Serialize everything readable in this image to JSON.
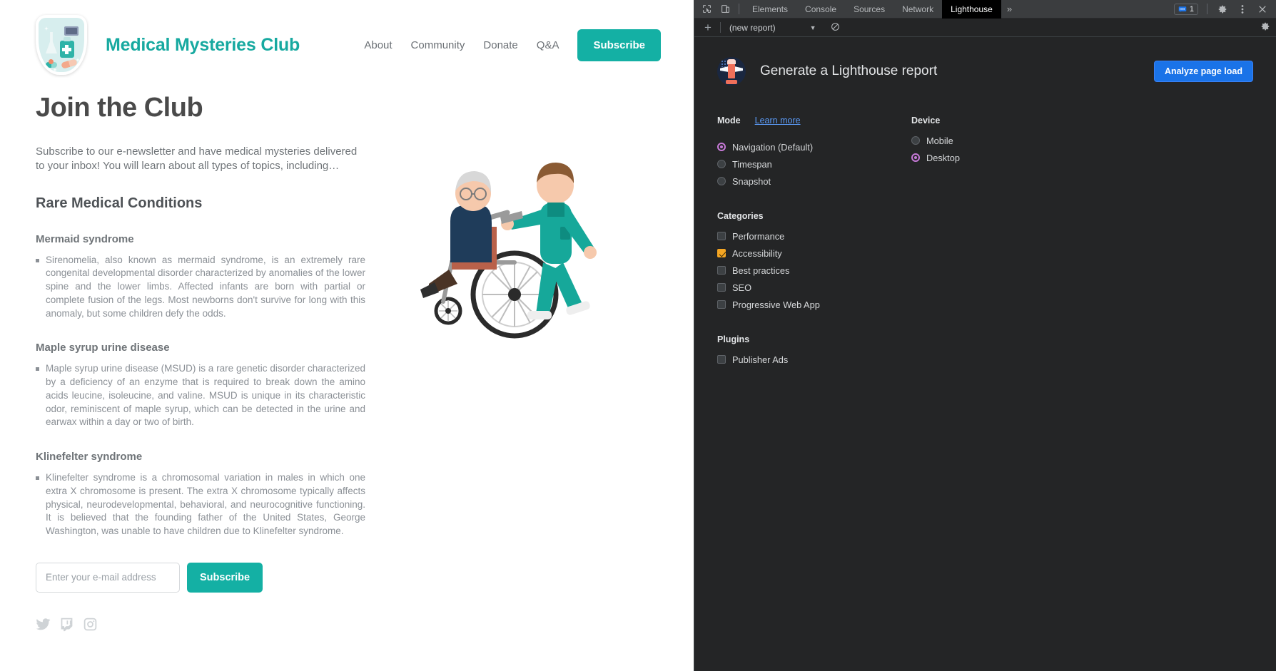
{
  "site": {
    "brand": "Medical Mysteries Club",
    "logo_icon": "medical-shield-logo",
    "nav": [
      {
        "label": "About"
      },
      {
        "label": "Community"
      },
      {
        "label": "Donate"
      },
      {
        "label": "Q&A"
      }
    ],
    "nav_cta": "Subscribe",
    "heading": "Join the Club",
    "lede": "Subscribe to our e-newsletter and have medical mysteries delivered to your inbox! You will learn about all types of topics, including…",
    "section_heading": "Rare Medical Conditions",
    "conditions": [
      {
        "title": "Mermaid syndrome",
        "body": "Sirenomelia, also known as mermaid syndrome, is an extremely rare congenital developmental disorder characterized by anomalies of the lower spine and the lower limbs. Affected infants are born with partial or complete fusion of the legs. Most newborns don't survive for long with this anomaly, but some children defy the odds."
      },
      {
        "title": "Maple syrup urine disease",
        "body": "Maple syrup urine disease (MSUD) is a rare genetic disorder characterized by a deficiency of an enzyme that is required to break down the amino acids leucine, isoleucine, and valine. MSUD is unique in its characteristic odor, reminiscent of maple syrup, which can be detected in the urine and earwax within a day or two of birth."
      },
      {
        "title": "Klinefelter syndrome",
        "body": "Klinefelter syndrome is a chromosomal variation in males in which one extra X chromosome is present. The extra X chromosome typically affects physical, neurodevelopmental, behavioral, and neurocognitive functioning. It is believed that the founding father of the United States, George Washington, was unable to have children due to Klinefelter syndrome."
      }
    ],
    "form": {
      "email_placeholder": "Enter your e-mail address",
      "email_value": "",
      "submit_label": "Subscribe"
    },
    "socials": [
      {
        "name": "twitter-icon"
      },
      {
        "name": "twitch-icon"
      },
      {
        "name": "instagram-icon"
      }
    ],
    "illustration": "nurse-pushing-elderly-patient-in-wheelchair",
    "accent_color": "#14b0a4",
    "brand_color": "#17a9a0"
  },
  "devtools": {
    "tabs": [
      {
        "label": "Elements",
        "active": false
      },
      {
        "label": "Console",
        "active": false
      },
      {
        "label": "Sources",
        "active": false
      },
      {
        "label": "Network",
        "active": false
      },
      {
        "label": "Lighthouse",
        "active": true
      }
    ],
    "overflow_label": "»",
    "message_count": "1",
    "toolbar_icons": [
      "inspect-icon",
      "device-toolbar-icon",
      "settings-gear-icon",
      "more-options-icon",
      "close-icon"
    ],
    "subbar": {
      "add_label": "+",
      "report_name": "(new report)",
      "clear_icon": "clear-icon",
      "settings_icon": "settings-gear-icon"
    },
    "lighthouse": {
      "title": "Generate a Lighthouse report",
      "logo_icon": "lighthouse-logo",
      "analyze_button": "Analyze page load",
      "mode": {
        "title": "Mode",
        "learn_more": "Learn more",
        "options": [
          {
            "label": "Navigation (Default)",
            "checked": true
          },
          {
            "label": "Timespan",
            "checked": false
          },
          {
            "label": "Snapshot",
            "checked": false
          }
        ]
      },
      "device": {
        "title": "Device",
        "options": [
          {
            "label": "Mobile",
            "checked": false
          },
          {
            "label": "Desktop",
            "checked": true
          }
        ]
      },
      "categories": {
        "title": "Categories",
        "options": [
          {
            "label": "Performance",
            "checked": false
          },
          {
            "label": "Accessibility",
            "checked": true
          },
          {
            "label": "Best practices",
            "checked": false
          },
          {
            "label": "SEO",
            "checked": false
          },
          {
            "label": "Progressive Web App",
            "checked": false
          }
        ]
      },
      "plugins": {
        "title": "Plugins",
        "options": [
          {
            "label": "Publisher Ads",
            "checked": false
          }
        ]
      },
      "accent_blue": "#1a73e8",
      "radio_accent": "#c77ad8",
      "checkbox_accent": "#f5a623"
    }
  }
}
